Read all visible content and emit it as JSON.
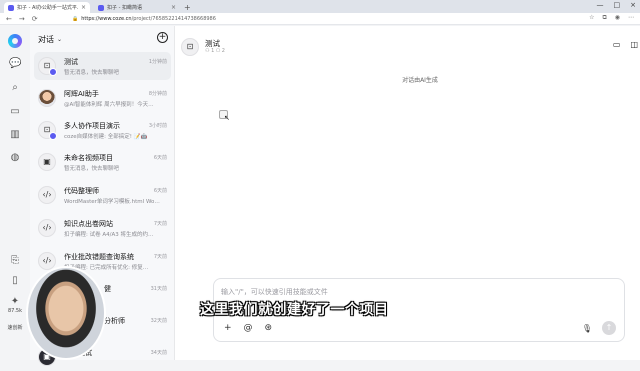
{
  "browser": {
    "tabs": [
      {
        "label": "扣子 - AI办公助手一站式平…",
        "active": true
      },
      {
        "label": "扣子 - 扣瞰简语",
        "active": false
      }
    ],
    "url_host": "https://www.coze.cn",
    "url_path": "/project/76585221414738668986"
  },
  "rail": {
    "stat_value": "87.5k",
    "stat_label": "速创新"
  },
  "list": {
    "title": "对话",
    "items": [
      {
        "name": "测试",
        "time": "1分钟前",
        "preview": "暂无消息，快去聊聊吧",
        "active": true
      },
      {
        "name": "阿辉AI助手",
        "time": "8分钟前",
        "preview": "@AI智能体利辉 周六早报到！今天…",
        "active": false
      },
      {
        "name": "多人协作项目演示",
        "time": "3小时前",
        "preview": "coze自媒体创建: 全部搞定! 📝🤖",
        "active": false
      },
      {
        "name": "未命名视频项目",
        "time": "6天前",
        "preview": "暂无消息，快去聊聊吧",
        "active": false
      },
      {
        "name": "代码整理师",
        "time": "6天前",
        "preview": "WordMaster单词学习模板.html Wo…",
        "active": false
      },
      {
        "name": "知识点出卷网站",
        "time": "7天前",
        "preview": "扣子编程: 试卷 A4/A3 将生成的约…",
        "active": false
      },
      {
        "name": "作业批改错题查询系统",
        "time": "7天前",
        "preview": "扣子编程: 已完成所有优化: 修复…",
        "active": false
      },
      {
        "name": "健",
        "time": "31天前",
        "preview": "",
        "active": false
      },
      {
        "name": "分析师",
        "time": "32天前",
        "preview": "",
        "active": false
      },
      {
        "name": "阿辉测试",
        "time": "34天前",
        "preview": "",
        "active": false
      }
    ]
  },
  "main": {
    "title": "测试",
    "sub": "⚇ 1  ⎔ 2",
    "generated_note": "对话由AI生成",
    "composer_placeholder": "输入\"/\"，可以快速引用技能或文件",
    "subtitle": "这里我们就创建好了一个项目"
  }
}
